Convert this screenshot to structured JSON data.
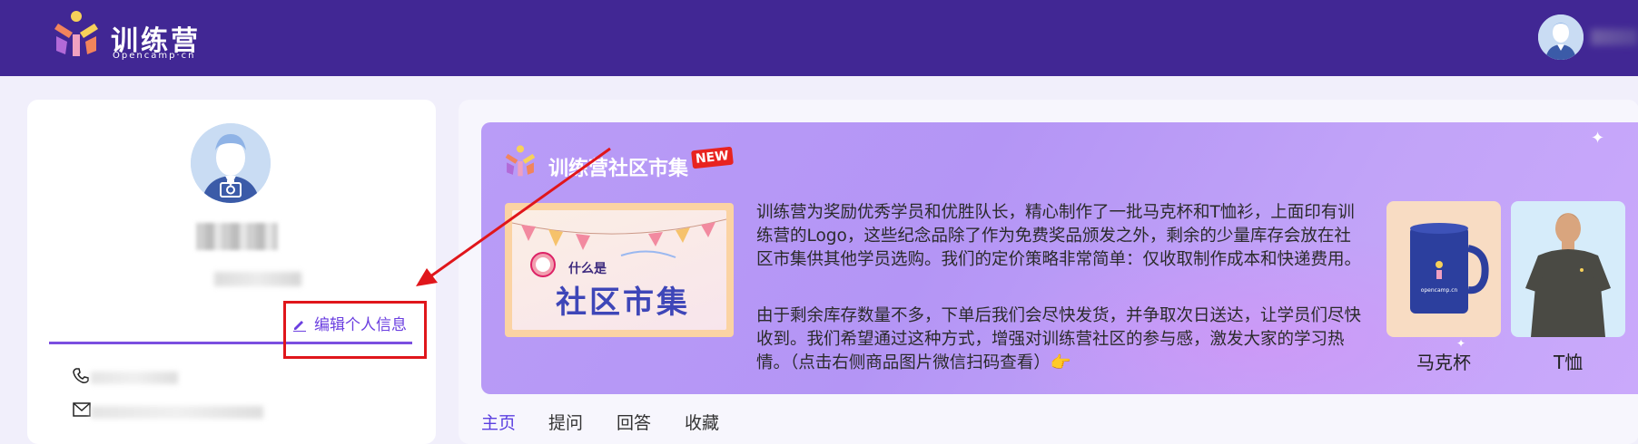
{
  "header": {
    "logo_title": "训练营",
    "logo_subtitle": "Opencamp·cn",
    "brand_color": "#412794"
  },
  "profile": {
    "edit_label": "编辑个人信息",
    "icons": [
      "camera-icon",
      "pencil-icon",
      "phone-icon",
      "mail-icon"
    ]
  },
  "banner": {
    "title": "训练营社区市集",
    "badge": "NEW",
    "poster_small": "什么是",
    "poster_big": "社区市集",
    "paragraph1": "训练营为奖励优秀学员和优胜队长，精心制作了一批马克杯和T恤衫，上面印有训练营的Logo，这些纪念品除了作为免费奖品颁发之外，剩余的少量库存会放在社区市集供其他学员选购。我们的定价策略非常简单：仅收取制作成本和快递费用。",
    "paragraph2": "由于剩余库存数量不多，下单后我们会尽快发货，并争取次日送达，让学员们尽快收到。我们希望通过这种方式，增强对训练营社区的参与感，激发大家的学习热情。（点击右侧商品图片微信扫码查看）👉",
    "products": [
      {
        "label": "马克杯",
        "icon": "mug-image"
      },
      {
        "label": "T恤",
        "icon": "tshirt-image"
      }
    ]
  },
  "tabs": [
    "主页",
    "提问",
    "回答",
    "收藏"
  ],
  "colors": {
    "accent": "#6b3fe0",
    "highlight": "#e0161b",
    "banner_bg": "#b99cf7"
  }
}
